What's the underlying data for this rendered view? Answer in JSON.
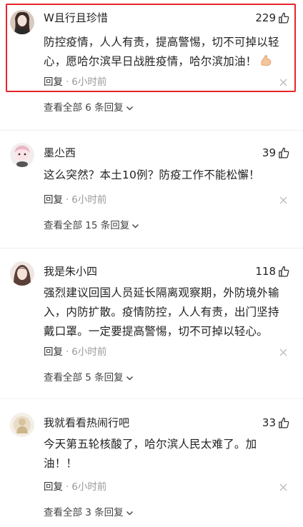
{
  "comments": [
    {
      "username": "W且行且珍惜",
      "likes": "229",
      "content": "防控疫情，人人有责，提高警惕，切不可掉以轻心，愿哈尔滨早日战胜疫情，哈尔滨加油！",
      "reply_label": "回复",
      "separator": "·",
      "time": "6小时前",
      "view_all": "查看全部 6 条回复",
      "highlighted": true,
      "has_emoji": true,
      "emoji_icon": "flexed-biceps-icon"
    },
    {
      "username": "墨尐西",
      "likes": "39",
      "content": "这么突然？本土10例？防疫工作不能松懈！",
      "reply_label": "回复",
      "separator": "·",
      "time": "6小时前",
      "view_all": "查看全部 15 条回复"
    },
    {
      "username": "我是朱小四",
      "likes": "118",
      "content": "强烈建议回国人员延长隔离观察期，外防境外输入，内防扩散。疫情防控，人人有责，出门坚持戴口罩。一定要提高警惕，切不可掉以轻心。",
      "reply_label": "回复",
      "separator": "·",
      "time": "6小时前",
      "view_all": "查看全部 5 条回复"
    },
    {
      "username": "我就看看热闹行吧",
      "likes": "33",
      "content": "今天第五轮核酸了，哈尔滨人民太难了。加油！！",
      "reply_label": "回复",
      "separator": "·",
      "time": "6小时前",
      "view_all": "查看全部 3 条回复"
    }
  ],
  "colors": {
    "highlight_border": "#e5262b",
    "text_primary": "#222222",
    "text_secondary": "#999999"
  },
  "icons": {
    "like": "thumbs-up-icon",
    "close": "close-icon",
    "expand": "chevron-down-icon"
  }
}
